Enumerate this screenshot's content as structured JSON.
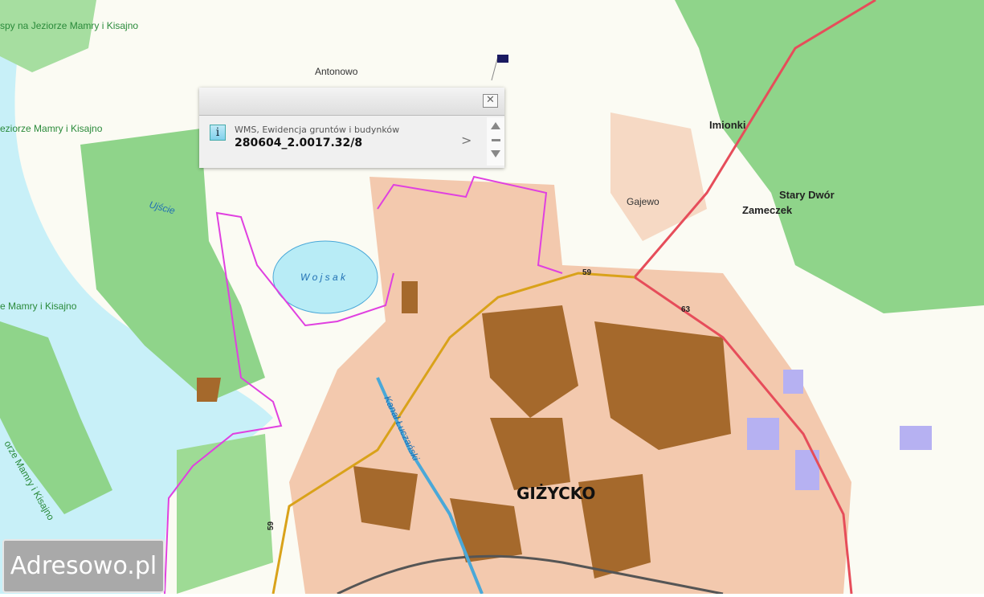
{
  "map": {
    "labels": {
      "lake_top": "spy na Jeziorze Mamry i Kisajno",
      "lake_mid": "eziorze Mamry i Kisajno",
      "lake_low": "e Mamry i Kisajno",
      "lake_bottom": "orze Mamry i Kisajno",
      "antonowo": "Antonowo",
      "ujscie": "Ujście",
      "wojsak": "W o j s a k",
      "imionki": "Imionki",
      "gajewo": "Gajewo",
      "stary_dwor": "Stary Dwór",
      "zameczek": "Zameczek",
      "gizycko": "GIŻYCKO",
      "kanal": "Kanał Łuczański",
      "road_59a": "59",
      "road_63": "63",
      "road_59b": "59"
    },
    "colors": {
      "water": "#c8f0f8",
      "forest": "#8fd48a",
      "urban": "#f3c9ae",
      "buildings": "#a5692c",
      "admin_border": "#e040e0",
      "road_main": "#e64d5a",
      "road_nat": "#d9a21a"
    }
  },
  "popup": {
    "close_icon": "close-icon",
    "info_icon_label": "i",
    "layer_name": "WMS, Ewidencja gruntów i budynków",
    "parcel_id": "280604_2.0017.32/8",
    "next_label": ">"
  },
  "logo": {
    "text": "Adresowo.pl"
  }
}
